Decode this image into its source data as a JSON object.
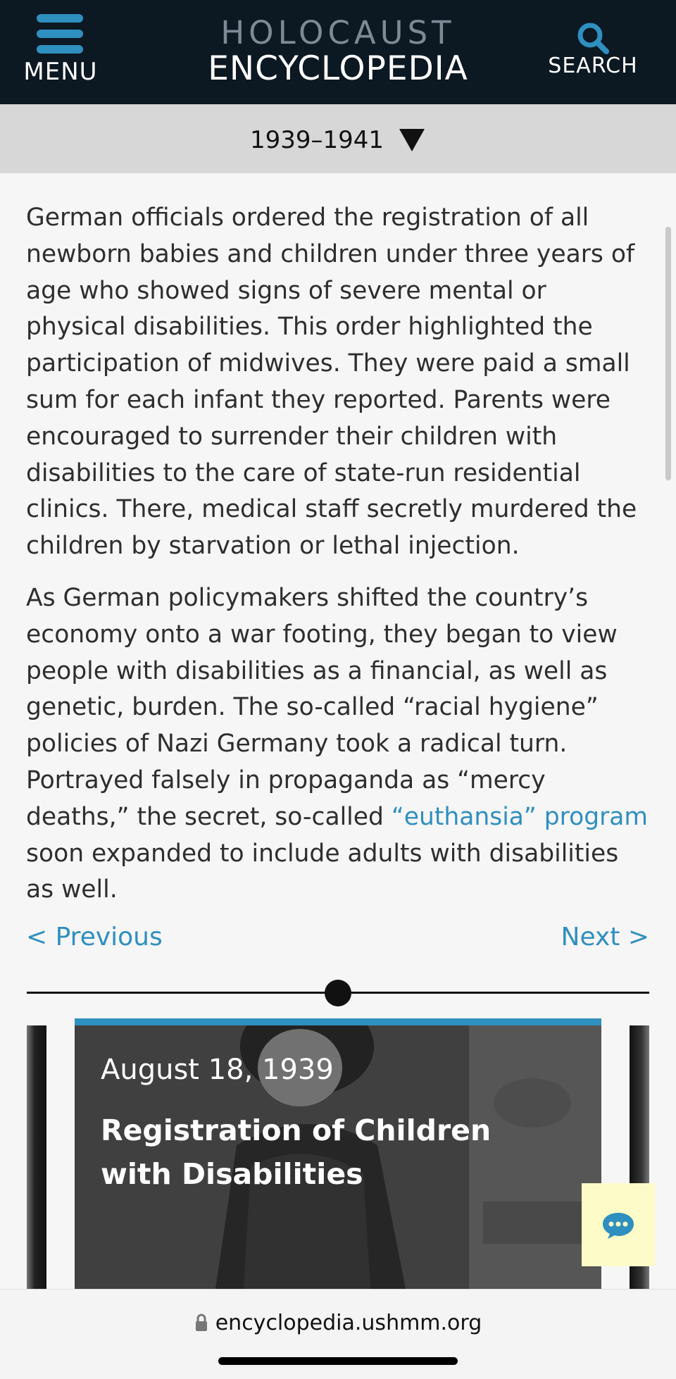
{
  "header": {
    "menu_label": "MENU",
    "logo_top": "HOLOCAUST",
    "logo_bottom": "ENCYCLOPEDIA",
    "search_label": "SEARCH"
  },
  "era_selector": {
    "label": "1939–1941"
  },
  "article": {
    "paragraph1": "German officials ordered the registration of all newborn babies and children under three years of age who showed signs of severe mental or physical disabilities. This order highlighted the participation of midwives. They were paid a small sum for each infant they reported. Parents were encouraged to surrender their children with disabilities to the care of state-run residential clinics. There, medical staff secretly murdered the children by starvation or lethal injection.",
    "paragraph2_before_link": "As German policymakers shifted the country’s economy onto a war footing, they began to view people with disabilities as a financial, as well as genetic, burden. The so-called “racial hygiene” policies of Nazi Germany took a radical turn. Portrayed falsely in propaganda as “mercy deaths,” the secret, so-called ",
    "paragraph2_link": "“euthansia” program",
    "paragraph2_after_link": " soon expanded to include adults with disabilities as well."
  },
  "pager": {
    "previous": "< Previous",
    "next": "Next >"
  },
  "event_card": {
    "date": "August 18, 1939",
    "title": "Registration of Children with Disabilities"
  },
  "browser": {
    "url": "encyclopedia.ushmm.org"
  },
  "colors": {
    "header_bg": "#0c1822",
    "accent": "#2f8fbf",
    "era_bar_bg": "#d7d7d8",
    "chat_bg": "#fdfcc8"
  },
  "icons": {
    "menu": "menu-icon",
    "search": "search-icon",
    "caret": "caret-down-icon",
    "chat": "chat-bubble-icon",
    "lock": "lock-icon"
  }
}
